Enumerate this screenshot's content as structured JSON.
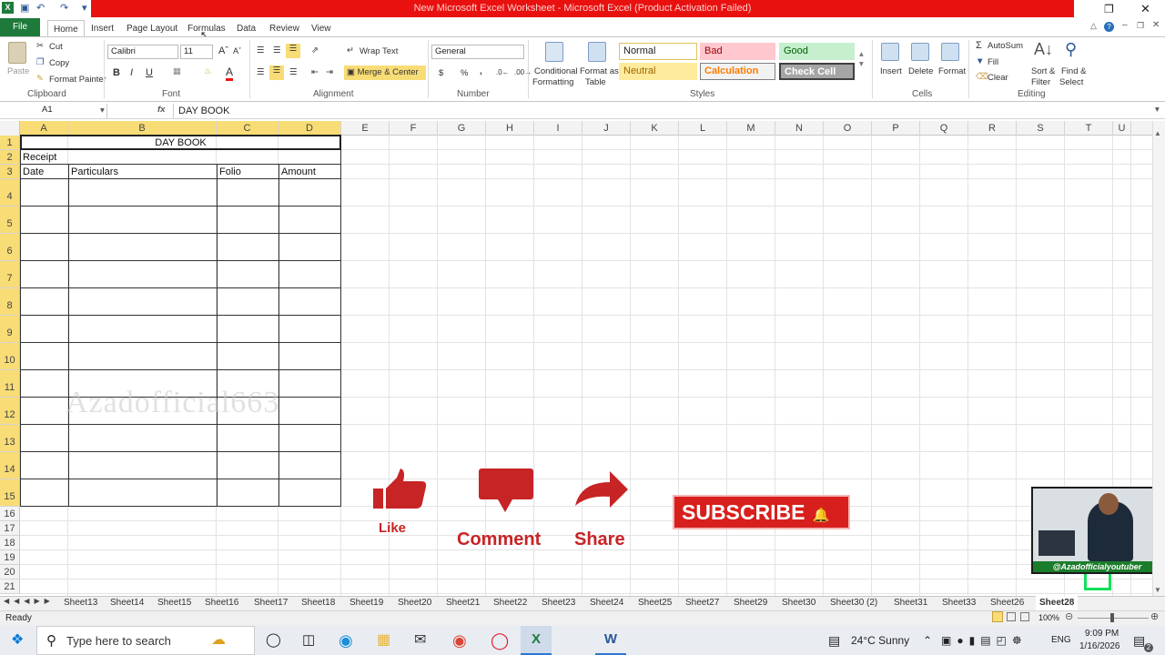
{
  "window": {
    "title": "New Microsoft Excel Worksheet  -  Microsoft Excel (Product Activation Failed)"
  },
  "ribbon": {
    "tabs": [
      "File",
      "Home",
      "Insert",
      "Page Layout",
      "Formulas",
      "Data",
      "Review",
      "View"
    ],
    "clipboard": {
      "paste": "Paste",
      "cut": "Cut",
      "copy": "Copy",
      "format_painter": "Format Painter",
      "label": "Clipboard"
    },
    "font": {
      "name": "Calibri",
      "size": "11",
      "bold": "B",
      "italic": "I",
      "underline": "U",
      "label": "Font"
    },
    "alignment": {
      "wrap": "Wrap Text",
      "merge": "Merge & Center",
      "label": "Alignment"
    },
    "number": {
      "format": "General",
      "currency": "$",
      "percent": "%",
      "comma": ",",
      "label": "Number"
    },
    "styles": {
      "conditional": "Conditional",
      "conditional2": "Formatting",
      "format_table": "Format as",
      "format_table2": "Table",
      "normal": "Normal",
      "bad": "Bad",
      "good": "Good",
      "neutral": "Neutral",
      "calculation": "Calculation",
      "check": "Check Cell",
      "label": "Styles"
    },
    "cells": {
      "insert": "Insert",
      "delete": "Delete",
      "format": "Format",
      "label": "Cells"
    },
    "editing": {
      "autosum": "AutoSum",
      "fill": "Fill",
      "clear": "Clear",
      "sort": "Sort &",
      "sort2": "Filter",
      "find": "Find &",
      "find2": "Select",
      "label": "Editing"
    }
  },
  "formula_bar": {
    "name_box": "A1",
    "fx": "fx",
    "content": "DAY BOOK"
  },
  "columns": [
    "A",
    "B",
    "C",
    "D",
    "E",
    "F",
    "G",
    "H",
    "I",
    "J",
    "K",
    "L",
    "M",
    "N",
    "O",
    "P",
    "Q",
    "R",
    "S",
    "T",
    "U"
  ],
  "rows": [
    "1",
    "2",
    "3",
    "4",
    "5",
    "6",
    "7",
    "8",
    "9",
    "10",
    "11",
    "12",
    "13",
    "14",
    "15",
    "16",
    "17",
    "18",
    "19",
    "20",
    "21"
  ],
  "sheet": {
    "title": "DAY BOOK",
    "receipt": "Receipt",
    "headers": [
      "Date",
      "Particulars",
      "Folio",
      "Amount"
    ]
  },
  "overlay": {
    "watermark": "Azadofficial663",
    "like": "Like",
    "comment": "Comment",
    "share": "Share",
    "subscribe": "SUBSCRIBE",
    "handle": "@Azadofficialyoutuber"
  },
  "sheet_tabs": [
    "Sheet13",
    "Sheet14",
    "Sheet15",
    "Sheet16",
    "Sheet17",
    "Sheet18",
    "Sheet19",
    "Sheet20",
    "Sheet21",
    "Sheet22",
    "Sheet23",
    "Sheet24",
    "Sheet25",
    "Sheet27",
    "Sheet29",
    "Sheet30",
    "Sheet30 (2)",
    "Sheet31",
    "Sheet33",
    "Sheet26",
    "Sheet28"
  ],
  "status": {
    "ready": "Ready",
    "zoom": "100%"
  },
  "taskbar": {
    "search": "Type here to search",
    "weather": "24°C  Sunny",
    "lang": "ENG",
    "time": "9:09 PM",
    "date": "1/16/2026",
    "notif": "2"
  },
  "colors": {
    "excel_green": "#1e7a3b",
    "title_red": "#e8110f",
    "promo_red": "#c72426",
    "header_yellow": "#f8dc76"
  }
}
